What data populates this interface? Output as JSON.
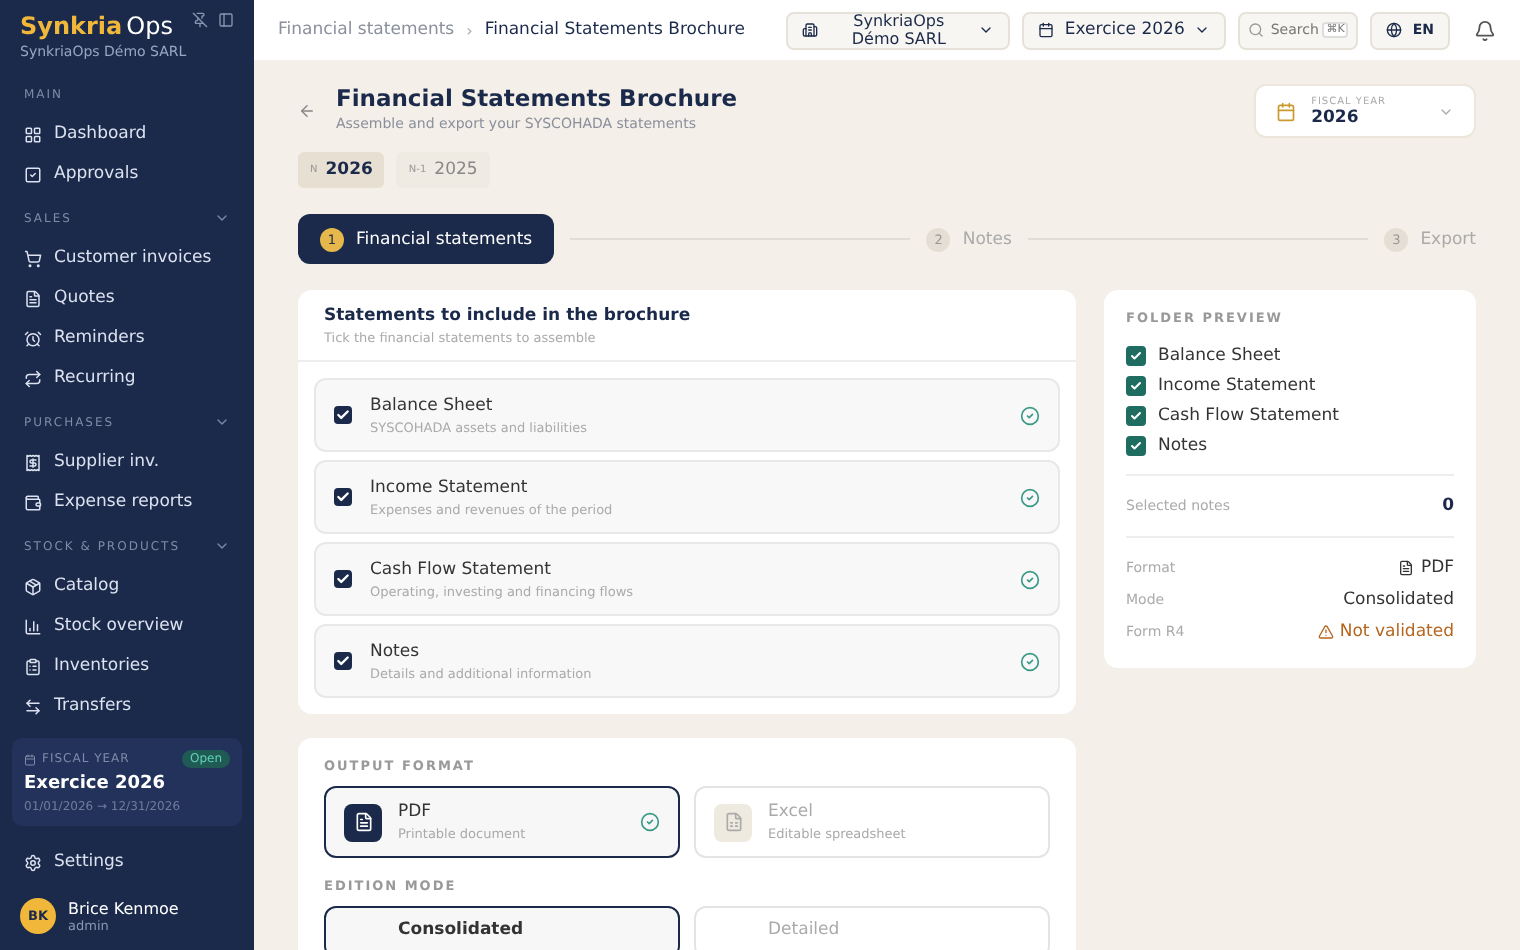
{
  "sidebar": {
    "logo": {
      "brand": "Synkria",
      "suffix": "Ops"
    },
    "company": "SynkriaOps Démo SARL",
    "sections": [
      {
        "label": "MAIN",
        "items": [
          {
            "label": "Dashboard"
          },
          {
            "label": "Approvals"
          }
        ]
      },
      {
        "label": "SALES",
        "expanded": true,
        "items": [
          {
            "label": "Customer invoices"
          },
          {
            "label": "Quotes"
          },
          {
            "label": "Reminders"
          },
          {
            "label": "Recurring"
          }
        ]
      },
      {
        "label": "PURCHASES",
        "expanded": true,
        "items": [
          {
            "label": "Supplier inv."
          },
          {
            "label": "Expense reports"
          }
        ]
      },
      {
        "label": "STOCK & PRODUCTS",
        "expanded": true,
        "items": [
          {
            "label": "Catalog"
          },
          {
            "label": "Stock overview"
          },
          {
            "label": "Inventories"
          },
          {
            "label": "Transfers"
          }
        ]
      }
    ],
    "fiscal_year": {
      "label": "FISCAL YEAR",
      "badge": "Open",
      "title": "Exercice 2026",
      "range": "01/01/2026 → 12/31/2026"
    },
    "settings": "Settings",
    "user": {
      "initials": "BK",
      "name": "Brice Kenmoe",
      "role": "admin"
    }
  },
  "topbar": {
    "breadcrumb": [
      "Financial statements",
      "Financial Statements Brochure"
    ],
    "separator": "›",
    "company": "SynkriaOps Démo SARL",
    "fiscal": "Exercice 2026",
    "search": {
      "placeholder": "Search",
      "shortcut": "⌘K"
    },
    "language": "EN"
  },
  "header": {
    "title": "Financial Statements Brochure",
    "subtitle": "Assemble and export your SYSCOHADA statements",
    "fiscal_select": {
      "label": "FISCAL YEAR",
      "value": "2026"
    }
  },
  "years": [
    {
      "tag": "N",
      "year": "2026",
      "selected": true
    },
    {
      "tag": "N-1",
      "year": "2025",
      "selected": false
    }
  ],
  "steps": [
    {
      "number": "1",
      "label": "Financial statements",
      "selected": true
    },
    {
      "number": "2",
      "label": "Notes",
      "selected": false
    },
    {
      "number": "3",
      "label": "Export",
      "selected": false
    }
  ],
  "statements": {
    "title": "Statements to include in the brochure",
    "subtitle": "Tick the financial statements to assemble",
    "items": [
      {
        "label": "Balance Sheet",
        "description": "SYSCOHADA assets and liabilities",
        "checked": true
      },
      {
        "label": "Income Statement",
        "description": "Expenses and revenues of the period",
        "checked": true
      },
      {
        "label": "Cash Flow Statement",
        "description": "Operating, investing and financing flows",
        "checked": true
      },
      {
        "label": "Notes",
        "description": "Details and additional information",
        "checked": true
      }
    ]
  },
  "output": {
    "format_title": "OUTPUT FORMAT",
    "formats": [
      {
        "label": "PDF",
        "description": "Printable document",
        "selected": true
      },
      {
        "label": "Excel",
        "description": "Editable spreadsheet",
        "selected": false
      }
    ],
    "mode_title": "EDITION MODE",
    "modes": [
      {
        "label": "Consolidated",
        "selected": true
      },
      {
        "label": "Detailed",
        "selected": false
      }
    ]
  },
  "preview": {
    "title": "FOLDER PREVIEW",
    "items": [
      {
        "label": "Balance Sheet",
        "checked": true
      },
      {
        "label": "Income Statement",
        "checked": true
      },
      {
        "label": "Cash Flow Statement",
        "checked": true
      },
      {
        "label": "Notes",
        "checked": true
      }
    ],
    "notes_label": "Selected notes",
    "notes_value": "0",
    "rows": [
      {
        "label": "Format",
        "value": "PDF",
        "kind": "file"
      },
      {
        "label": "Mode",
        "value": "Consolidated",
        "kind": "plain"
      },
      {
        "label": "Form R4",
        "value": "Not validated",
        "kind": "warning"
      }
    ]
  }
}
